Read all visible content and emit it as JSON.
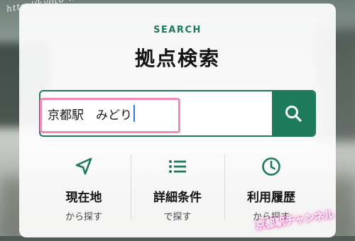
{
  "watermark": {
    "top": "http://kyoto-wr.com",
    "bottom": "京都駅チャンネル"
  },
  "header": {
    "eyebrow": "SEARCH",
    "title": "拠点検索"
  },
  "search": {
    "value": "京都駅　みどり",
    "button_icon": "search-icon"
  },
  "options": [
    {
      "label": "現在地",
      "sub": "から探す",
      "icon": "location-arrow-icon"
    },
    {
      "label": "詳細条件",
      "sub": "で探す",
      "icon": "list-icon"
    },
    {
      "label": "利用履歴",
      "sub": "から探す",
      "icon": "clock-icon"
    }
  ],
  "colors": {
    "accent": "#1d7a5a",
    "highlight": "#f08ab8"
  }
}
